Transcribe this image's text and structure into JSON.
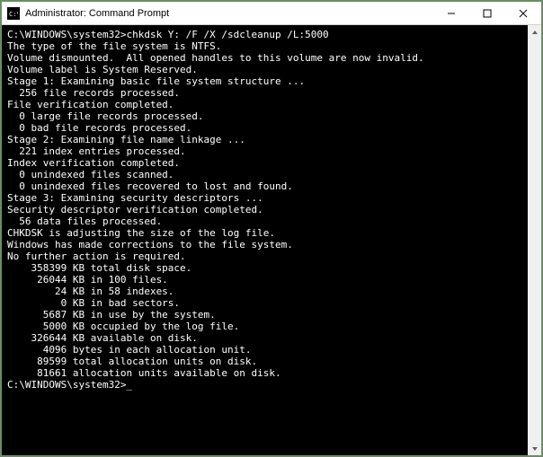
{
  "window": {
    "title": "Administrator: Command Prompt"
  },
  "output": {
    "line01": "C:\\WINDOWS\\system32>chkdsk Y: /F /X /sdcleanup /L:5000",
    "line02": "The type of the file system is NTFS.",
    "line03": "Volume dismounted.  All opened handles to this volume are now invalid.",
    "line04": "Volume label is System Reserved.",
    "line05": "",
    "line06": "Stage 1: Examining basic file system structure ...",
    "line07": "  256 file records processed.",
    "line08": "File verification completed.",
    "line09": "  0 large file records processed.",
    "line10": "  0 bad file records processed.",
    "line11": "",
    "line12": "Stage 2: Examining file name linkage ...",
    "line13": "  221 index entries processed.",
    "line14": "Index verification completed.",
    "line15": "  0 unindexed files scanned.",
    "line16": "  0 unindexed files recovered to lost and found.",
    "line17": "",
    "line18": "Stage 3: Examining security descriptors ...",
    "line19": "Security descriptor verification completed.",
    "line20": "  56 data files processed.",
    "line21": "CHKDSK is adjusting the size of the log file.",
    "line22": "",
    "line23": "Windows has made corrections to the file system.",
    "line24": "No further action is required.",
    "line25": "",
    "line26": "    358399 KB total disk space.",
    "line27": "     26044 KB in 100 files.",
    "line28": "        24 KB in 58 indexes.",
    "line29": "         0 KB in bad sectors.",
    "line30": "      5687 KB in use by the system.",
    "line31": "      5000 KB occupied by the log file.",
    "line32": "    326644 KB available on disk.",
    "line33": "",
    "line34": "      4096 bytes in each allocation unit.",
    "line35": "     89599 total allocation units on disk.",
    "line36": "     81661 allocation units available on disk.",
    "line37": ""
  },
  "prompt": {
    "text": "C:\\WINDOWS\\system32>",
    "cursor": "_"
  }
}
